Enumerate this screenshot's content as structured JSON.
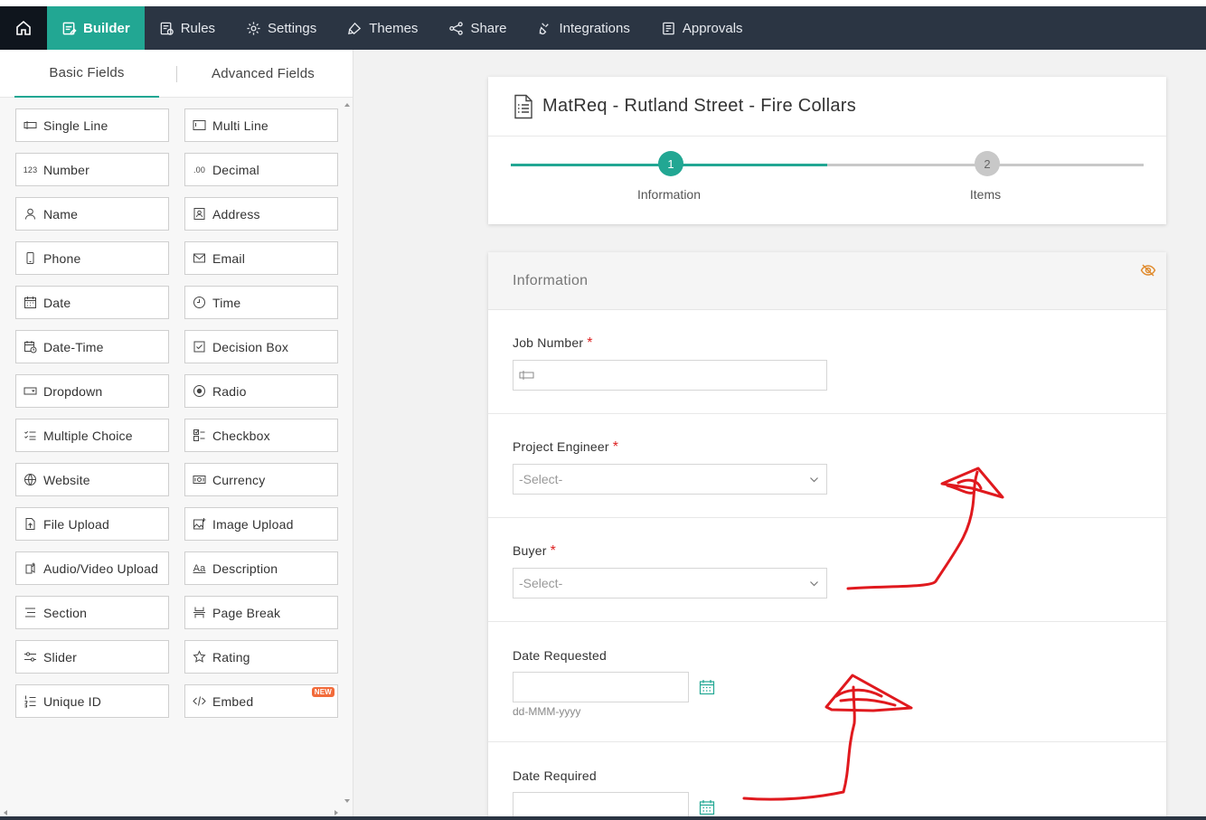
{
  "nav": {
    "items": [
      {
        "label": "Builder",
        "icon": "builder-icon",
        "active": true
      },
      {
        "label": "Rules",
        "icon": "rules-icon"
      },
      {
        "label": "Settings",
        "icon": "gear-icon"
      },
      {
        "label": "Themes",
        "icon": "brush-icon"
      },
      {
        "label": "Share",
        "icon": "share-icon"
      },
      {
        "label": "Integrations",
        "icon": "plug-icon"
      },
      {
        "label": "Approvals",
        "icon": "approvals-icon"
      }
    ],
    "accent": "#22a793",
    "bar_color": "#2b3543"
  },
  "sidebar": {
    "tabs": {
      "basic": "Basic Fields",
      "advanced": "Advanced Fields"
    },
    "fields": [
      {
        "label": "Single Line",
        "icon": "single-line-icon"
      },
      {
        "label": "Multi Line",
        "icon": "multi-line-icon"
      },
      {
        "label": "Number",
        "icon": "number-icon"
      },
      {
        "label": "Decimal",
        "icon": "decimal-icon"
      },
      {
        "label": "Name",
        "icon": "person-icon"
      },
      {
        "label": "Address",
        "icon": "address-icon"
      },
      {
        "label": "Phone",
        "icon": "phone-icon"
      },
      {
        "label": "Email",
        "icon": "envelope-icon"
      },
      {
        "label": "Date",
        "icon": "calendar-icon"
      },
      {
        "label": "Time",
        "icon": "clock-icon"
      },
      {
        "label": "Date-Time",
        "icon": "date-time-icon"
      },
      {
        "label": "Decision Box",
        "icon": "checkbox-icon"
      },
      {
        "label": "Dropdown",
        "icon": "dropdown-icon"
      },
      {
        "label": "Radio",
        "icon": "radio-icon"
      },
      {
        "label": "Multiple Choice",
        "icon": "multiple-choice-icon"
      },
      {
        "label": "Checkbox",
        "icon": "checklist-icon"
      },
      {
        "label": "Website",
        "icon": "globe-icon"
      },
      {
        "label": "Currency",
        "icon": "currency-icon"
      },
      {
        "label": "File Upload",
        "icon": "file-upload-icon"
      },
      {
        "label": "Image Upload",
        "icon": "image-upload-icon"
      },
      {
        "label": "Audio/Video Upload",
        "icon": "media-upload-icon"
      },
      {
        "label": "Description",
        "icon": "description-icon"
      },
      {
        "label": "Section",
        "icon": "section-icon"
      },
      {
        "label": "Page Break",
        "icon": "page-break-icon"
      },
      {
        "label": "Slider",
        "icon": "slider-icon"
      },
      {
        "label": "Rating",
        "icon": "star-icon"
      },
      {
        "label": "Unique ID",
        "icon": "unique-id-icon"
      },
      {
        "label": "Embed",
        "icon": "code-icon",
        "badge": "NEW"
      }
    ],
    "number_icon_text": "123",
    "decimal_icon_text": ".00"
  },
  "form": {
    "title": "MatReq - Rutland Street - Fire Collars",
    "steps": [
      {
        "number": "1",
        "label": "Information",
        "active": true
      },
      {
        "number": "2",
        "label": "Items",
        "active": false
      }
    ],
    "section": {
      "title": "Information",
      "fields": [
        {
          "label": "Job Number",
          "required": true,
          "type": "text"
        },
        {
          "label": "Project Engineer",
          "required": true,
          "type": "select",
          "placeholder": "-Select-"
        },
        {
          "label": "Buyer",
          "required": true,
          "type": "select",
          "placeholder": "-Select-"
        },
        {
          "label": "Date Requested",
          "required": false,
          "type": "date",
          "hint": "dd-MMM-yyyy"
        },
        {
          "label": "Date Required",
          "required": false,
          "type": "date"
        }
      ]
    },
    "required_mark": "*"
  }
}
